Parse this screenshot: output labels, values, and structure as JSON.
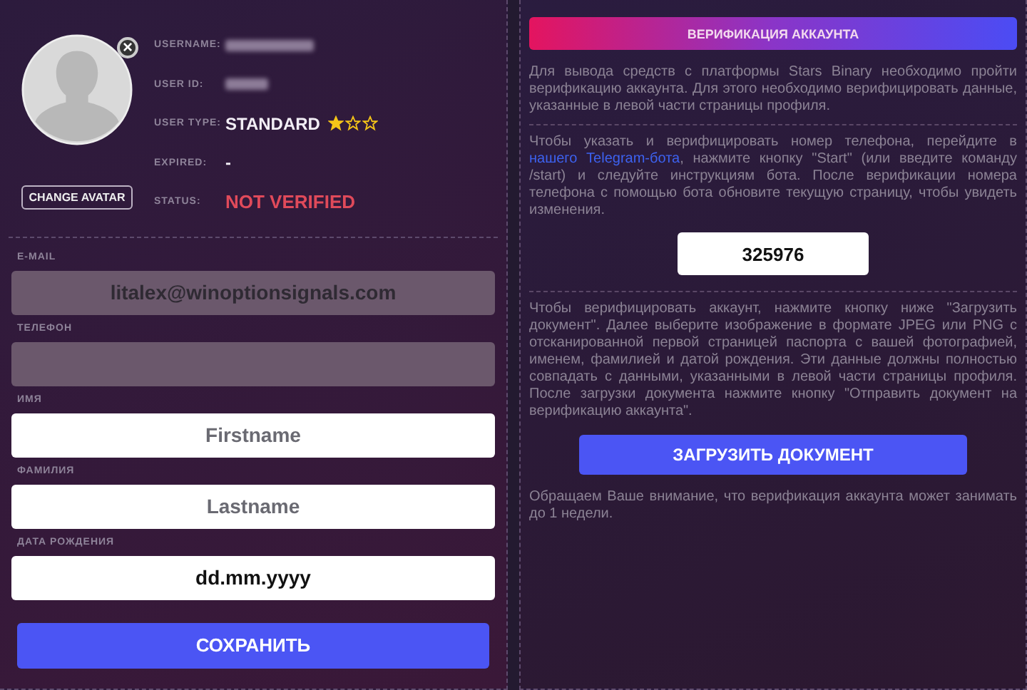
{
  "profile": {
    "avatar_remove": "×",
    "change_avatar": "CHANGE AVATAR",
    "info": [
      {
        "kind": "redacted",
        "label": "USERNAME:"
      },
      {
        "kind": "redacted_short",
        "label": "USER ID:"
      },
      {
        "kind": "type",
        "label": "USER TYPE:",
        "value": "STANDARD",
        "stars": 1
      },
      {
        "kind": "plain",
        "label": "EXPIRED:",
        "value": "-"
      },
      {
        "kind": "status",
        "label": "STATUS:",
        "value": "NOT VERIFIED"
      }
    ]
  },
  "form": {
    "fields": [
      {
        "label": "E-MAIL",
        "value": "litalex@winoptionsignals.com",
        "disabled": true
      },
      {
        "label": "ТЕЛЕФОН",
        "disabled": true
      },
      {
        "label": "ИМЯ",
        "placeholder": "Firstname",
        "disabled": false
      },
      {
        "label": "ФАМИЛИЯ",
        "placeholder": "Lastname",
        "disabled": false
      },
      {
        "label": "ДАТА РОЖДЕНИЯ",
        "value": "dd.mm.yyyy",
        "disabled": false
      }
    ],
    "save": "СОХРАНИТЬ"
  },
  "verification": {
    "title": "ВЕРИФИКАЦИЯ АККАУНТА",
    "intro": "Для вывода средств с платформы Stars Binary необходимо пройти верификацию аккаунта. Для этого необходимо верифицировать данные, указанные в левой части страницы профиля.",
    "phone_before": "Чтобы указать и верифицировать номер телефона, перейдите в ",
    "phone_link": "нашего Telegram-бота",
    "phone_after": ", нажмите кнопку \"Start\" (или введите команду /start) и следуйте инструкциям бота. После верификации номера телефона с помощью бота обновите текущую страницу, чтобы увидеть изменения.",
    "code": "325976",
    "document": "Чтобы верифицировать аккаунт, нажмите кнопку ниже \"Загрузить документ\". Далее выберите изображение в формате JPEG или PNG с отсканированной первой страницей паспорта с вашей фотографией, именем, фамилией и датой рождения. Эти данные должны полностью совпадать с данными, указанными в левой части страницы профиля. После загрузки документа нажмите кнопку \"Отправить документ на верификацию аккаунта\".",
    "upload": "ЗАГРУЗИТЬ ДОКУМЕНТ",
    "note": "Обращаем Ваше внимание, что верификация аккаунта может занимать до 1 недели."
  }
}
